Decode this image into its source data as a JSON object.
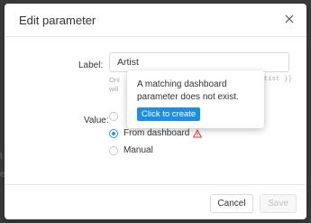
{
  "background": {
    "fragment_1": "t",
    "fragment_2": "e"
  },
  "dialog": {
    "title": "Edit parameter",
    "close_icon": "close-icon",
    "label_field": {
      "label": "Label:",
      "value": "Artist",
      "help_left": "Onl",
      "help_left_2": "will",
      "help_right": "rtist }}"
    },
    "value_field": {
      "label": "Value:",
      "options": [
        {
          "label": "",
          "checked": false
        },
        {
          "label": "From dashboard",
          "checked": true,
          "icon": "warning-icon"
        },
        {
          "label": "Manual",
          "checked": false
        }
      ]
    },
    "popover": {
      "message": "A matching dashboard parameter does not exist.",
      "button": "Click to create"
    },
    "footer": {
      "cancel": "Cancel",
      "save": "Save"
    },
    "colors": {
      "accent": "#2196f3",
      "button_blue": "#1a8fe3",
      "warning": "#e53935"
    }
  }
}
